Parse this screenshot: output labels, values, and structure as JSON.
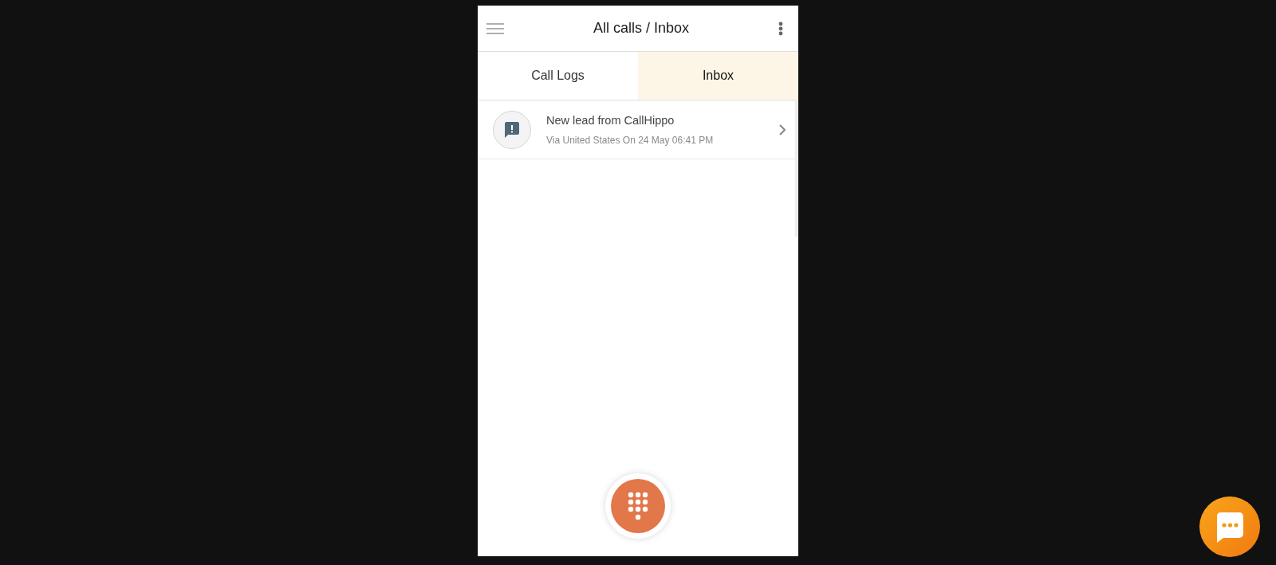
{
  "header": {
    "title": "All calls / Inbox"
  },
  "tabs": [
    {
      "label": "Call Logs",
      "selected": false
    },
    {
      "label": "Inbox",
      "selected": true
    }
  ],
  "messages": [
    {
      "title": "New lead from CallHippo",
      "subtitle": "Via United States On 24 May 06:41 PM"
    }
  ]
}
